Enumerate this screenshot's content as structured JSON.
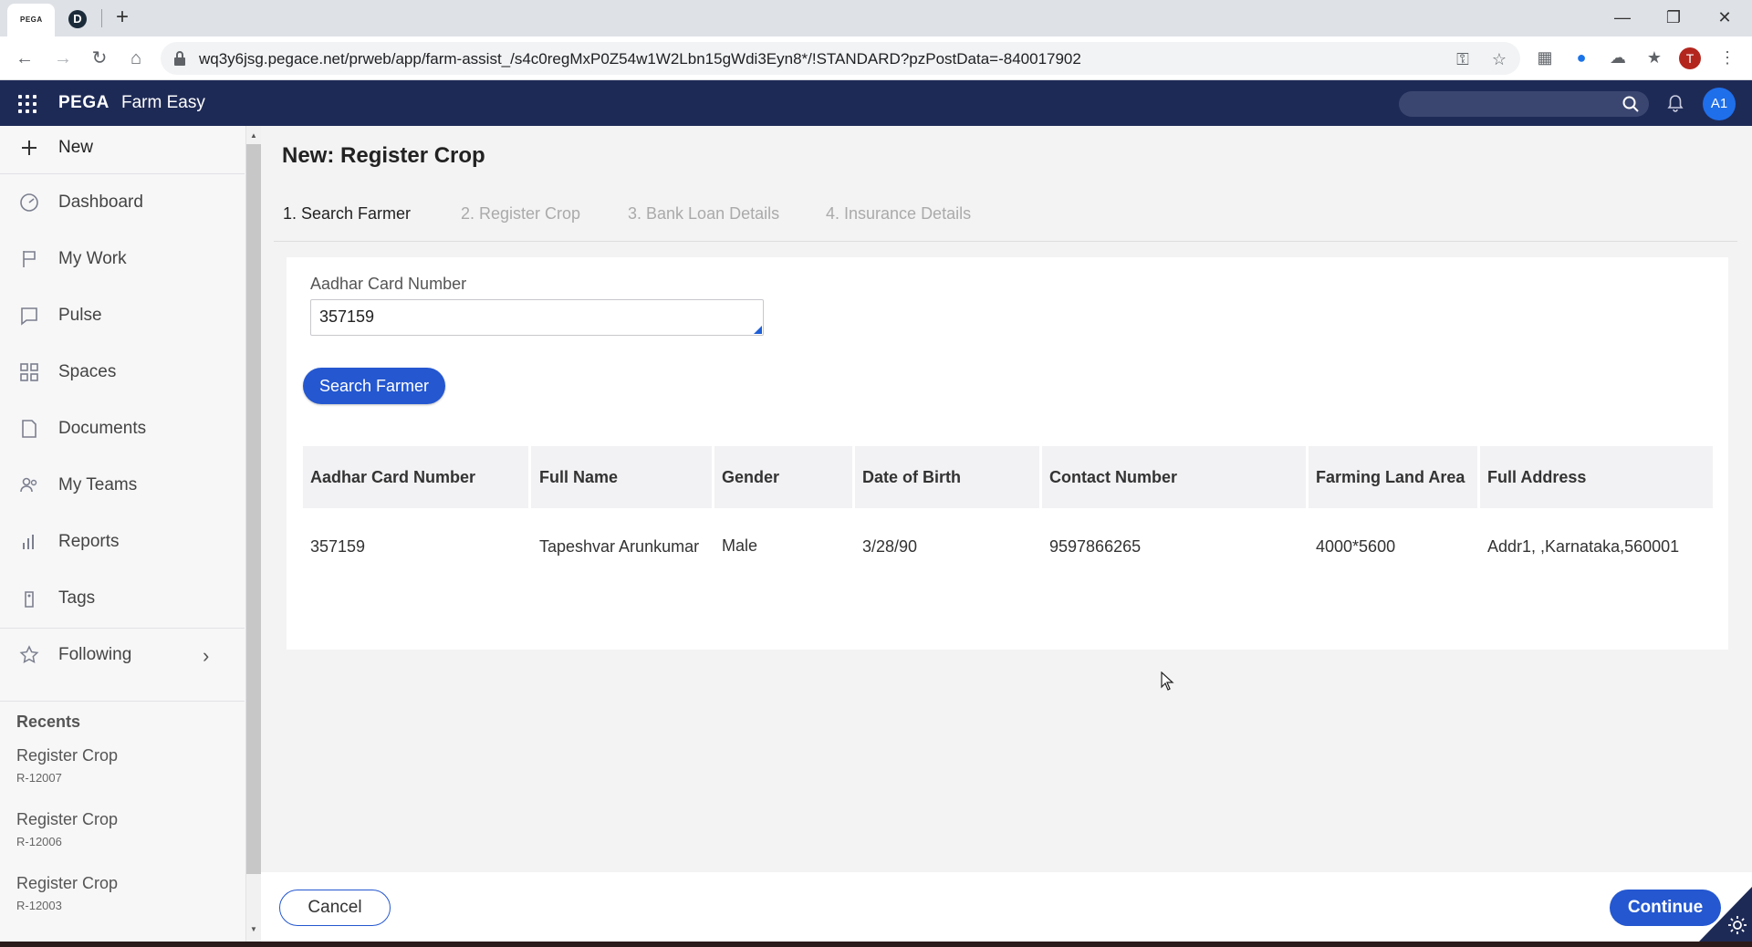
{
  "browser": {
    "tabs": [
      {
        "favicon_text": "PEGA"
      },
      {
        "favicon_text": "D"
      }
    ],
    "url": "wq3y6jsg.pegace.net/prweb/app/farm-assist_/s4c0regMxP0Z54w1W2Lbn15gWdi3Eyn8*/!STANDARD?pzPostData=-840017902",
    "profile_initial": "T"
  },
  "header": {
    "brand": "PEGA",
    "app_name": "Farm Easy",
    "avatar": "A1",
    "search_placeholder": ""
  },
  "sidebar": {
    "items": [
      {
        "label": "New",
        "icon": "plus-icon"
      },
      {
        "label": "Dashboard",
        "icon": "dashboard-icon"
      },
      {
        "label": "My Work",
        "icon": "flag-icon"
      },
      {
        "label": "Pulse",
        "icon": "chat-icon"
      },
      {
        "label": "Spaces",
        "icon": "grid-icon"
      },
      {
        "label": "Documents",
        "icon": "document-icon"
      },
      {
        "label": "My Teams",
        "icon": "people-icon"
      },
      {
        "label": "Reports",
        "icon": "bar-chart-icon"
      },
      {
        "label": "Tags",
        "icon": "tag-icon"
      },
      {
        "label": "Following",
        "icon": "star-icon"
      }
    ],
    "recents_title": "Recents",
    "recents": [
      {
        "title": "Register Crop",
        "id": "R-12007"
      },
      {
        "title": "Register Crop",
        "id": "R-12006"
      },
      {
        "title": "Register Crop",
        "id": "R-12003"
      }
    ]
  },
  "main": {
    "title": "New:  Register Crop",
    "steps": [
      {
        "label": "1. Search Farmer",
        "active": true
      },
      {
        "label": "2. Register Crop",
        "active": false
      },
      {
        "label": "3. Bank Loan Details",
        "active": false
      },
      {
        "label": "4. Insurance Details",
        "active": false
      }
    ],
    "field_label": "Aadhar Card Number",
    "field_value": "357159",
    "search_button": "Search Farmer",
    "table": {
      "columns": [
        "Aadhar Card Number",
        "Full Name",
        "Gender",
        "Date of Birth",
        "Contact Number",
        "Farming Land Area",
        "Full Address"
      ],
      "rows": [
        [
          "357159",
          "Tapeshvar Arunkumar",
          "Male",
          "3/28/90",
          "9597866265",
          "4000*5600",
          "Addr1, ,Karnataka,560001"
        ]
      ]
    }
  },
  "footer": {
    "cancel": "Cancel",
    "continue": "Continue"
  },
  "colors": {
    "header_bg": "#1e2a56",
    "primary": "#2457d0"
  }
}
